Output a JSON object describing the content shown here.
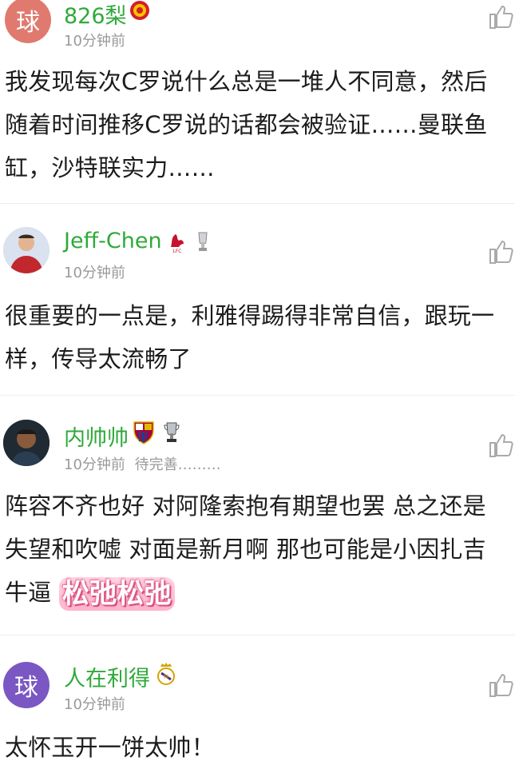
{
  "comments": [
    {
      "avatar_char": "球",
      "avatar_color": "#e07a6e",
      "username": "826梨",
      "badges": [
        "man-utd-crest-icon"
      ],
      "time": "10分钟前",
      "status": "",
      "lines": [
        "我发现每次C罗说什么总是一堆人不同意，然后",
        "随着时间推移C罗说的话都会被验证……曼联鱼",
        "缸，沙特联实力……"
      ]
    },
    {
      "avatar_char": "",
      "avatar_color": "#b8322f",
      "username": "Jeff-Chen",
      "badges": [
        "liverpool-crest-icon",
        "trophy-icon"
      ],
      "time": "10分钟前",
      "status": "",
      "lines": [
        "很重要的一点是，利雅得踢得非常自信，跟玩一",
        "样，传导太流畅了"
      ]
    },
    {
      "avatar_char": "",
      "avatar_color": "#3a3a3a",
      "username": "内帅帅",
      "badges": [
        "barcelona-crest-icon",
        "trophy-icon"
      ],
      "time": "10分钟前",
      "status": "待完善………",
      "lines": [
        "阵容不齐也好 对阿隆索抱有期望也罢 总之还是",
        "失望和吹嘘 对面是新月啊 那也可能是小因扎吉",
        "牛逼"
      ],
      "sticker": "松弛松弛"
    },
    {
      "avatar_char": "球",
      "avatar_color": "#7a57c2",
      "username": "人在利得",
      "badges": [
        "real-madrid-crest-icon"
      ],
      "time": "10分钟前",
      "status": "",
      "lines": [
        "太怀玉开一饼太帅！"
      ]
    }
  ]
}
